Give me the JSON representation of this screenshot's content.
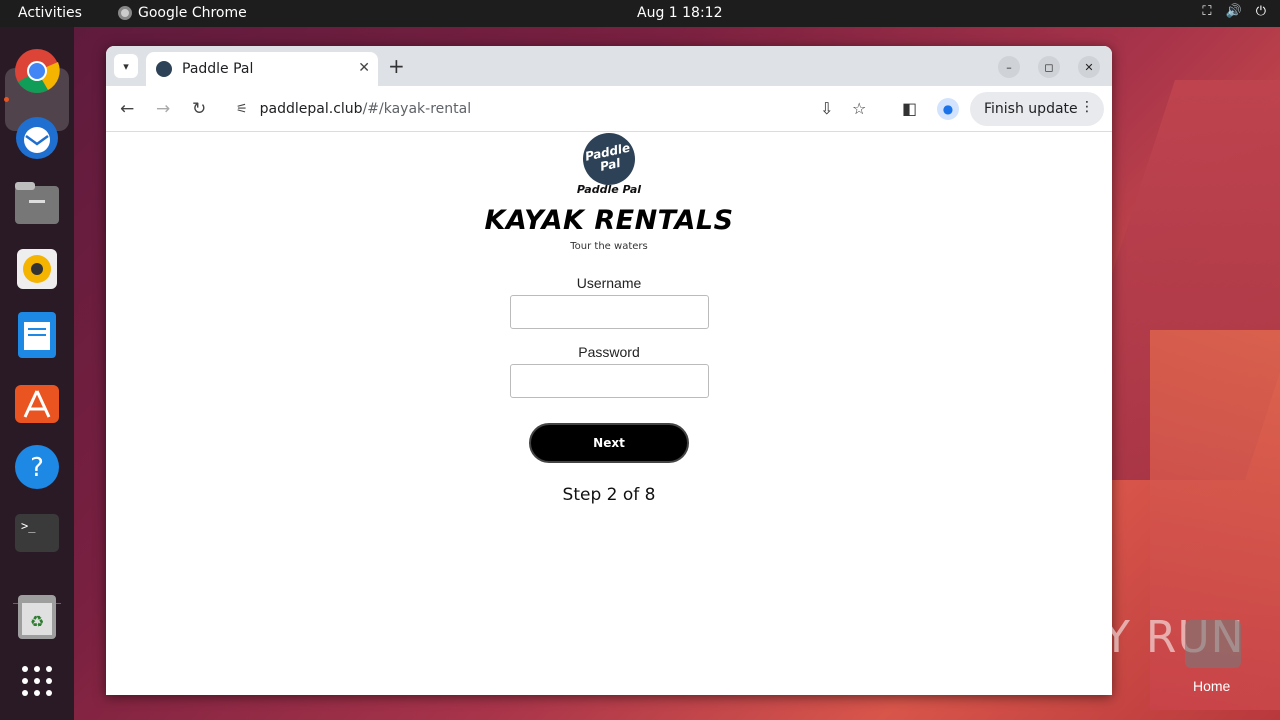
{
  "topbar": {
    "activities": "Activities",
    "app_name": "Google Chrome",
    "clock": "Aug 1  18:12"
  },
  "browser": {
    "tab_title": "Paddle Pal",
    "url_host": "paddlepal.club",
    "url_path": "/#/kayak-rental",
    "finish_update": "Finish update"
  },
  "page": {
    "logo_text_line1": "Paddle",
    "logo_text_line2": "Pal",
    "logo_caption": "Paddle Pal",
    "title": "KAYAK RENTALS",
    "subtitle": "Tour the waters",
    "username_label": "Username",
    "password_label": "Password",
    "next_button": "Next",
    "step_text": "Step 2 of 8"
  },
  "desktop": {
    "watermark": "ANY RUN",
    "home_label": "Home"
  }
}
